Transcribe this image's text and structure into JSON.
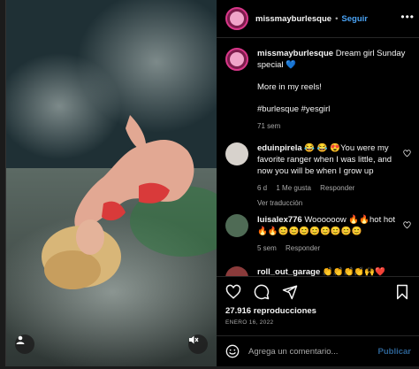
{
  "post": {
    "username": "missmayburlesque",
    "follow_label": "Seguir",
    "caption": "Dream girl Sunday special 💙",
    "caption_extra": "More in my reels!",
    "hashtags": "#burlesque #yesgirl",
    "caption_time": "71 sem"
  },
  "comments": [
    {
      "username": "eduinpirela",
      "text": "😂 😂 😍You were my favorite ranger when I was little, and now you will be when I grow up",
      "time": "6 d",
      "likes": "1 Me gusta",
      "reply": "Responder",
      "translate": "Ver traducción"
    },
    {
      "username": "luisalex776",
      "text": "Woooooow 🔥🔥hot hot 🔥🔥😊😊😊😊😊😊😊😊",
      "time": "5 sem",
      "reply": "Responder"
    },
    {
      "username": "roll_out_garage",
      "text": "👏👏👏👏🙌❤️"
    }
  ],
  "stats": {
    "views": "27.916 reproducciones",
    "date": "ENERO 16, 2022"
  },
  "composer": {
    "placeholder": "Agrega un comentario...",
    "post_label": "Publicar"
  },
  "icons": {
    "more": "more-options-icon",
    "like": "heart-icon",
    "comment": "comment-icon",
    "share": "share-icon",
    "save": "bookmark-icon",
    "emoji": "emoji-icon",
    "user": "user-tag-icon",
    "mute": "muted-speaker-icon"
  },
  "colors": {
    "link": "#4aa3f5",
    "background": "#000000",
    "secondary_text": "#a8a8a8",
    "avatar_ring": "#d9378a"
  }
}
